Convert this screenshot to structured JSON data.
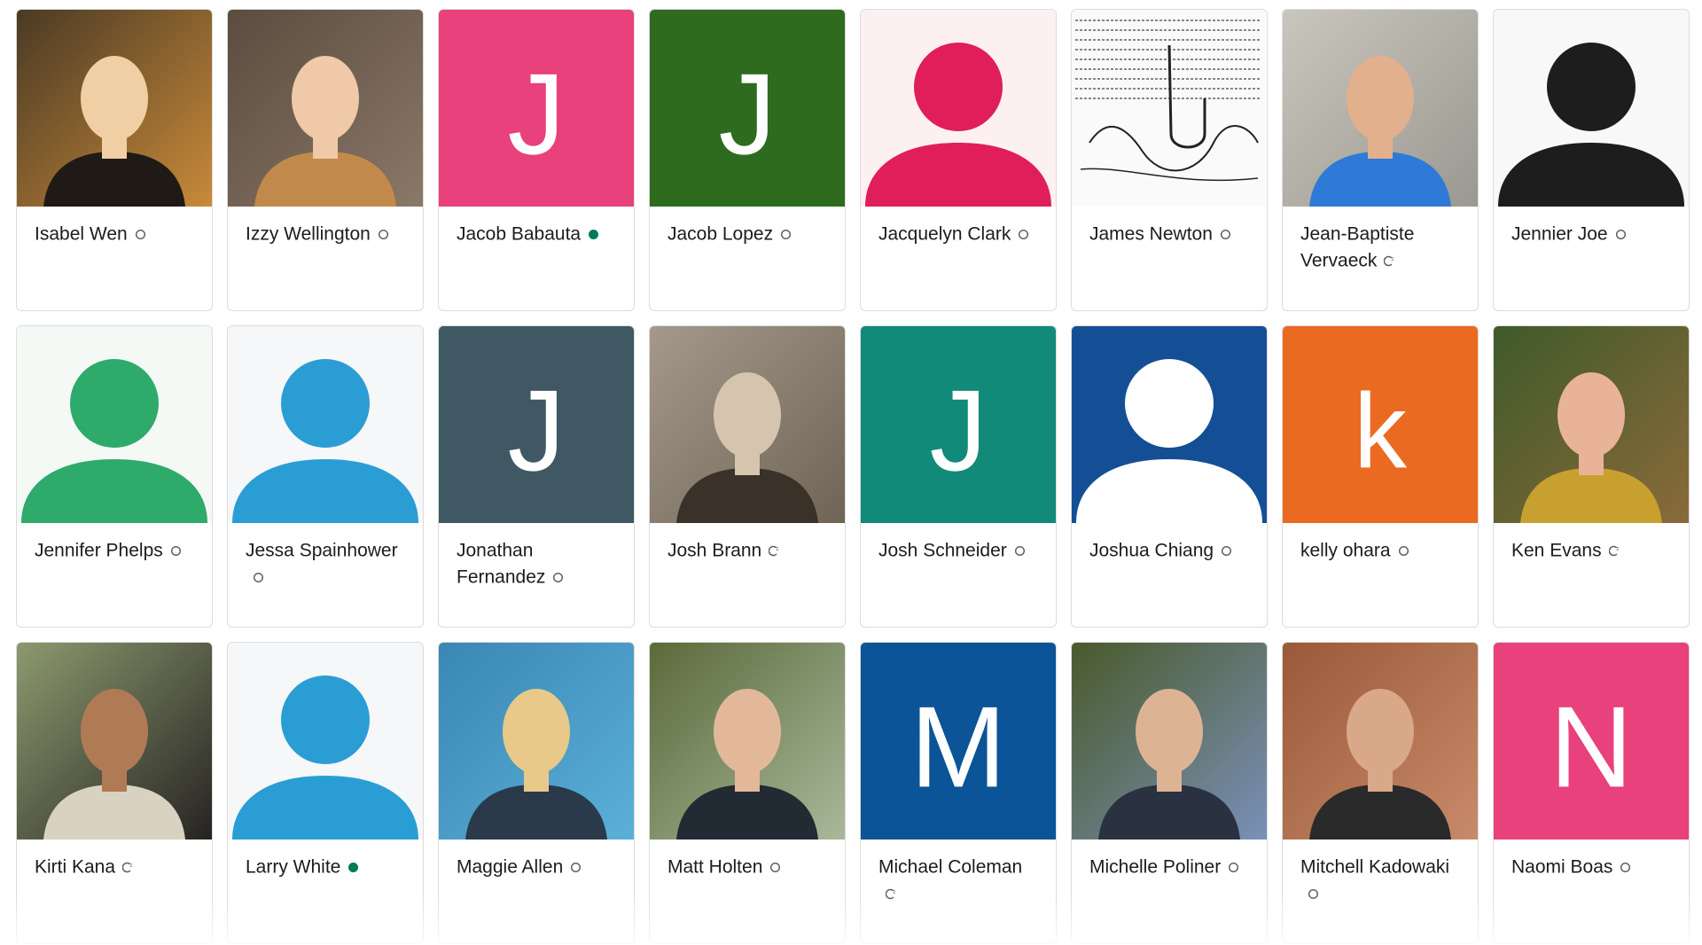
{
  "members": [
    {
      "name": "Isabel Wen",
      "status": "away",
      "avatar": {
        "kind": "photo",
        "palette": [
          "#4a3a24",
          "#c98a3a",
          "#f1cfa4",
          "#1f1a16"
        ]
      }
    },
    {
      "name": "Izzy Wellington",
      "status": "away",
      "avatar": {
        "kind": "photo",
        "palette": [
          "#5b4c3f",
          "#8a7868",
          "#f0c9a8",
          "#c28a4a"
        ]
      }
    },
    {
      "name": "Jacob Babauta",
      "status": "active",
      "avatar": {
        "kind": "initial",
        "letter": "J",
        "bg": "#e8417c",
        "fg": "#ffffff"
      }
    },
    {
      "name": "Jacob Lopez",
      "status": "away",
      "avatar": {
        "kind": "initial",
        "letter": "J",
        "bg": "#2f6b1f",
        "fg": "#ffffff"
      }
    },
    {
      "name": "Jacquelyn Clark",
      "status": "away",
      "avatar": {
        "kind": "silhouette",
        "bg": "#fdf0f3",
        "fg": "#e01e5a"
      }
    },
    {
      "name": "James Newton",
      "status": "away",
      "avatar": {
        "kind": "sketch",
        "bg": "#fafafa",
        "fg": "#222222"
      }
    },
    {
      "name": "Jean-Baptiste Vervaeck",
      "status": "snooze",
      "avatar": {
        "kind": "photo",
        "palette": [
          "#c9c6bd",
          "#9a9890",
          "#e2b08c",
          "#2e7ad6"
        ]
      }
    },
    {
      "name": "Jennier Joe",
      "status": "away",
      "avatar": {
        "kind": "silhouette",
        "bg": "#f8f8f8",
        "fg": "#1d1d1d"
      }
    },
    {
      "name": "Jennifer Phelps",
      "status": "away",
      "avatar": {
        "kind": "silhouette",
        "bg": "#f4f9f6",
        "fg": "#2eaa6b"
      }
    },
    {
      "name": "Jessa Spainhower",
      "status": "away",
      "avatar": {
        "kind": "silhouette",
        "bg": "#f6f7f8",
        "fg": "#2a9ed4"
      }
    },
    {
      "name": "Jonathan Fernandez",
      "status": "away",
      "avatar": {
        "kind": "initial",
        "letter": "J",
        "bg": "#3f5863",
        "fg": "#ffffff"
      }
    },
    {
      "name": "Josh Brann",
      "status": "snooze",
      "avatar": {
        "kind": "photo",
        "palette": [
          "#a4998a",
          "#6f6456",
          "#d6c5ae",
          "#3a3128"
        ]
      }
    },
    {
      "name": "Josh Schneider",
      "status": "away",
      "avatar": {
        "kind": "initial",
        "letter": "J",
        "bg": "#128a79",
        "fg": "#ffffff"
      }
    },
    {
      "name": "Joshua Chiang",
      "status": "away",
      "avatar": {
        "kind": "silhouette",
        "bg": "#144f96",
        "fg": "#ffffff"
      }
    },
    {
      "name": "kelly ohara",
      "status": "away",
      "avatar": {
        "kind": "initial",
        "letter": "k",
        "bg": "#eb6a21",
        "fg": "#ffffff"
      }
    },
    {
      "name": "Ken Evans",
      "status": "snooze",
      "avatar": {
        "kind": "photo",
        "palette": [
          "#3f5a2a",
          "#8a6a3a",
          "#e9b39a",
          "#c8a030"
        ]
      }
    },
    {
      "name": "Kirti Kana",
      "status": "snooze",
      "avatar": {
        "kind": "photo",
        "palette": [
          "#8c9a6e",
          "#262322",
          "#b07a55",
          "#d9d2c0"
        ]
      }
    },
    {
      "name": "Larry White",
      "status": "active",
      "avatar": {
        "kind": "silhouette",
        "bg": "#f6f7f8",
        "fg": "#2a9ed4"
      }
    },
    {
      "name": "Maggie Allen",
      "status": "away",
      "avatar": {
        "kind": "photo",
        "palette": [
          "#3a87b4",
          "#5bb0d8",
          "#e8c98a",
          "#2a3a4a"
        ]
      }
    },
    {
      "name": "Matt Holten",
      "status": "away",
      "avatar": {
        "kind": "photo",
        "palette": [
          "#5a6a3a",
          "#a8b89a",
          "#e3b89a",
          "#222a33"
        ]
      }
    },
    {
      "name": "Michael Coleman",
      "status": "snooze",
      "avatar": {
        "kind": "initial",
        "letter": "M",
        "bg": "#0b5497",
        "fg": "#ffffff"
      }
    },
    {
      "name": "Michelle Poliner",
      "status": "away",
      "avatar": {
        "kind": "photo",
        "palette": [
          "#4a5a2a",
          "#7a90b8",
          "#dcb494",
          "#2a3140"
        ]
      }
    },
    {
      "name": "Mitchell Kadowaki",
      "status": "away",
      "avatar": {
        "kind": "photo",
        "palette": [
          "#9a5a3a",
          "#c98a6a",
          "#d9a888",
          "#2a2a2a"
        ]
      }
    },
    {
      "name": "Naomi Boas",
      "status": "away",
      "avatar": {
        "kind": "initial",
        "letter": "N",
        "bg": "#e8417c",
        "fg": "#ffffff"
      }
    }
  ],
  "colors": {
    "active": "#007a5a",
    "away": "#616061",
    "text": "#1d1c1d"
  }
}
